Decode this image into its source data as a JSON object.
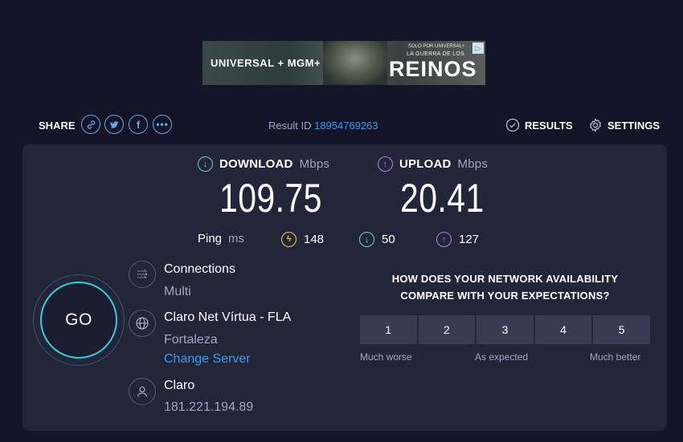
{
  "ad": {
    "brand_text": "UNIVERSAL + MGM+",
    "small_text": "SOLO POR UNIVERSAL+",
    "subtitle": "LA GUERRA DE LOS",
    "title": "REINOS",
    "adchoices_icon": "adchoices-icon"
  },
  "toolbar": {
    "share_label": "SHARE",
    "share_icons": [
      "link-icon",
      "twitter-icon",
      "facebook-icon",
      "more-icon"
    ],
    "result_prefix": "Result ID",
    "result_id": "18954769263",
    "results_label": "RESULTS",
    "settings_label": "SETTINGS"
  },
  "download": {
    "label": "DOWNLOAD",
    "unit": "Mbps",
    "value": "109.75",
    "color": "#6fd4cf"
  },
  "upload": {
    "label": "UPLOAD",
    "unit": "Mbps",
    "value": "20.41",
    "color": "#b07ff0"
  },
  "ping": {
    "label": "Ping",
    "unit": "ms",
    "idle": "148",
    "download": "50",
    "upload": "127",
    "idle_color": "#f2d33c",
    "download_color": "#6fd4cf",
    "upload_color": "#b07ff0"
  },
  "go": {
    "label": "GO",
    "ring_color": "#3fc9d8"
  },
  "connections": {
    "title": "Connections",
    "value": "Multi"
  },
  "server": {
    "name": "Claro Net Vírtua - FLA",
    "city": "Fortaleza",
    "change_label": "Change Server"
  },
  "isp": {
    "name": "Claro",
    "ip": "181.221.194.89"
  },
  "survey": {
    "question_line1": "HOW DOES YOUR NETWORK AVAILABILITY",
    "question_line2": "COMPARE WITH YOUR EXPECTATIONS?",
    "options": [
      "1",
      "2",
      "3",
      "4",
      "5"
    ],
    "scale": {
      "low": "Much worse",
      "mid": "As expected",
      "high": "Much better"
    }
  }
}
